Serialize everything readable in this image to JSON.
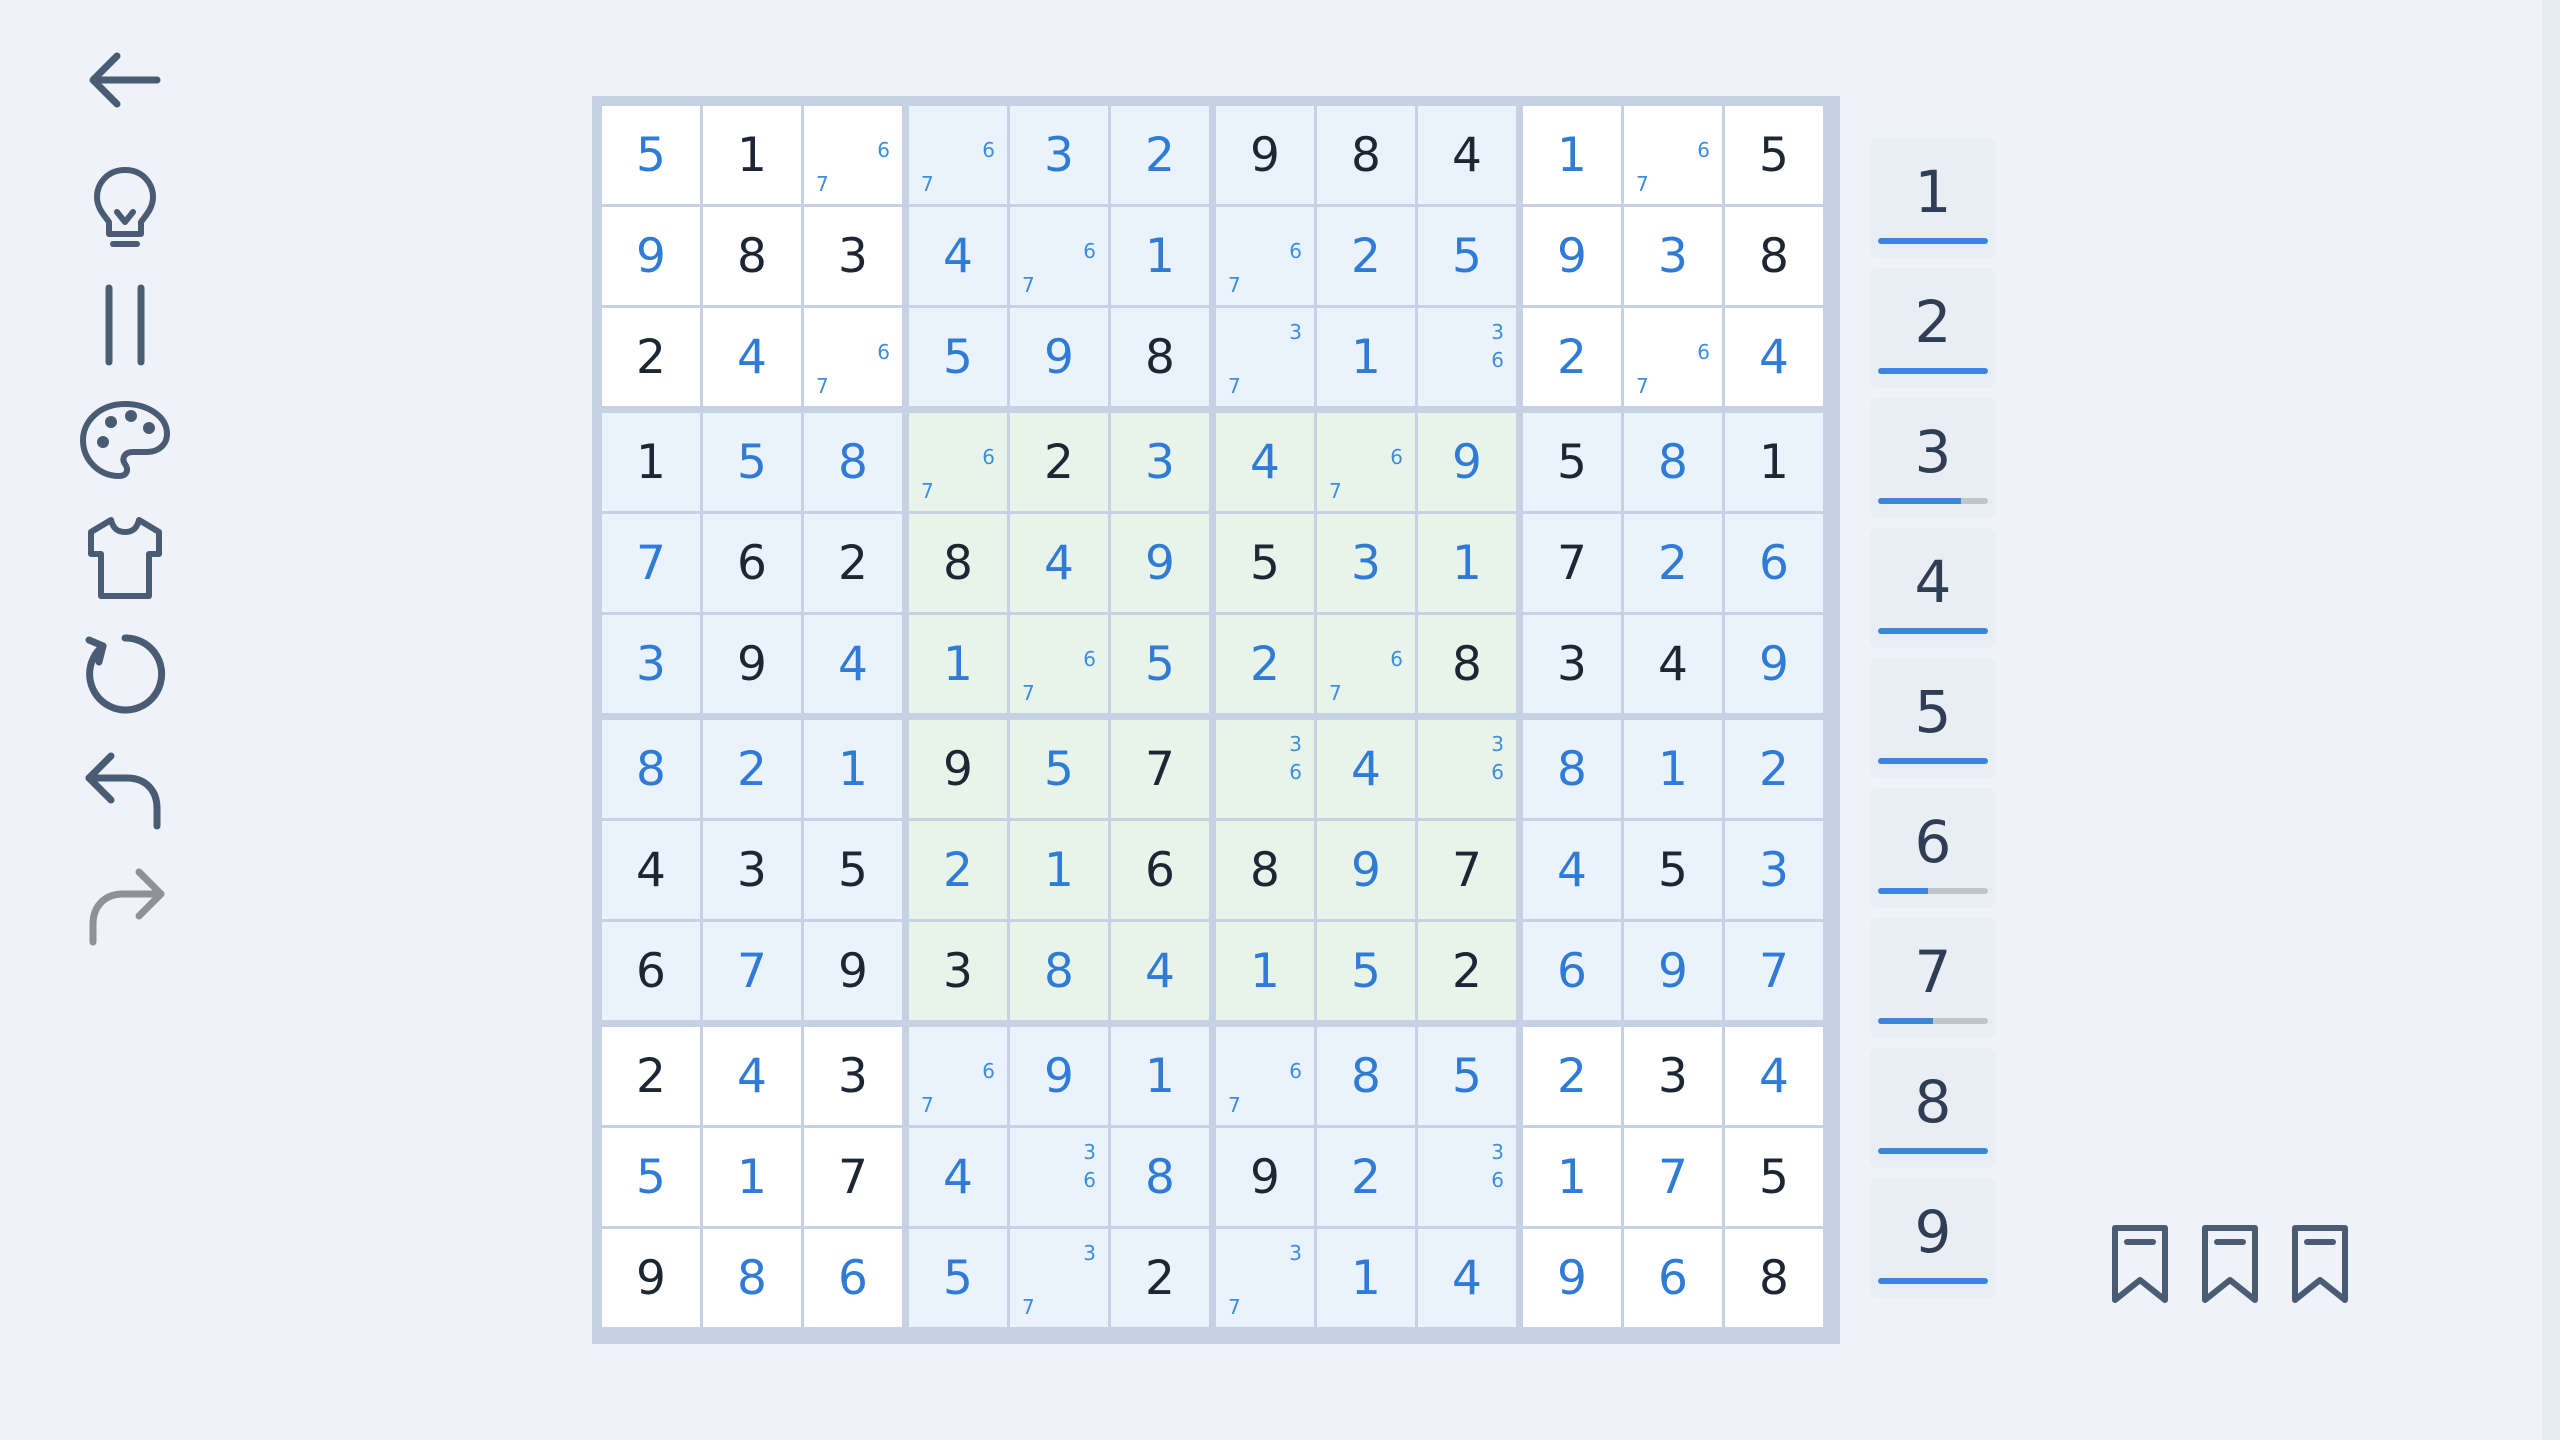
{
  "toolbar": {
    "icons": [
      "back-arrow-icon",
      "lightbulb-hint-icon",
      "pause-icon",
      "palette-icon",
      "shirt-icon",
      "restart-icon",
      "undo-icon",
      "redo-icon"
    ]
  },
  "board": {
    "rows": [
      [
        {
          "v": "5",
          "t": "u"
        },
        {
          "v": "1",
          "t": "g"
        },
        {
          "n": [
            "6",
            "7"
          ]
        },
        {
          "n": [
            "6",
            "7"
          ]
        },
        {
          "v": "3",
          "t": "u"
        },
        {
          "v": "2",
          "t": "u"
        },
        {
          "v": "9",
          "t": "g"
        },
        {
          "v": "8",
          "t": "g"
        },
        {
          "v": "4",
          "t": "g"
        },
        {
          "v": "1",
          "t": "u"
        },
        {
          "n": [
            "6",
            "7"
          ]
        },
        {
          "v": "5",
          "t": "g"
        }
      ],
      [
        {
          "v": "9",
          "t": "u"
        },
        {
          "v": "8",
          "t": "g"
        },
        {
          "v": "3",
          "t": "g"
        },
        {
          "v": "4",
          "t": "u"
        },
        {
          "n": [
            "6",
            "7"
          ]
        },
        {
          "v": "1",
          "t": "u"
        },
        {
          "n": [
            "6",
            "7"
          ]
        },
        {
          "v": "2",
          "t": "u"
        },
        {
          "v": "5",
          "t": "u"
        },
        {
          "v": "9",
          "t": "u"
        },
        {
          "v": "3",
          "t": "u"
        },
        {
          "v": "8",
          "t": "g"
        }
      ],
      [
        {
          "v": "2",
          "t": "g"
        },
        {
          "v": "4",
          "t": "u"
        },
        {
          "n": [
            "6",
            "7"
          ]
        },
        {
          "v": "5",
          "t": "u"
        },
        {
          "v": "9",
          "t": "u"
        },
        {
          "v": "8",
          "t": "g"
        },
        {
          "n": [
            "3",
            "7"
          ]
        },
        {
          "v": "1",
          "t": "u"
        },
        {
          "n": [
            "3",
            "6"
          ]
        },
        {
          "v": "2",
          "t": "u"
        },
        {
          "n": [
            "6",
            "7"
          ]
        },
        {
          "v": "4",
          "t": "u"
        }
      ],
      [
        {
          "v": "1",
          "t": "g"
        },
        {
          "v": "5",
          "t": "u"
        },
        {
          "v": "8",
          "t": "u"
        },
        {
          "n": [
            "6",
            "7"
          ]
        },
        {
          "v": "2",
          "t": "g"
        },
        {
          "v": "3",
          "t": "u"
        },
        {
          "v": "4",
          "t": "u"
        },
        {
          "n": [
            "6",
            "7"
          ]
        },
        {
          "v": "9",
          "t": "u"
        },
        {
          "v": "5",
          "t": "g"
        },
        {
          "v": "8",
          "t": "u"
        },
        {
          "v": "1",
          "t": "g"
        }
      ],
      [
        {
          "v": "7",
          "t": "u"
        },
        {
          "v": "6",
          "t": "g"
        },
        {
          "v": "2",
          "t": "g"
        },
        {
          "v": "8",
          "t": "g"
        },
        {
          "v": "4",
          "t": "u"
        },
        {
          "v": "9",
          "t": "u"
        },
        {
          "v": "5",
          "t": "g"
        },
        {
          "v": "3",
          "t": "u"
        },
        {
          "v": "1",
          "t": "u"
        },
        {
          "v": "7",
          "t": "g"
        },
        {
          "v": "2",
          "t": "u"
        },
        {
          "v": "6",
          "t": "u"
        }
      ],
      [
        {
          "v": "3",
          "t": "u"
        },
        {
          "v": "9",
          "t": "g"
        },
        {
          "v": "4",
          "t": "u"
        },
        {
          "v": "1",
          "t": "u"
        },
        {
          "n": [
            "6",
            "7"
          ]
        },
        {
          "v": "5",
          "t": "u"
        },
        {
          "v": "2",
          "t": "u"
        },
        {
          "n": [
            "6",
            "7"
          ]
        },
        {
          "v": "8",
          "t": "g"
        },
        {
          "v": "3",
          "t": "g"
        },
        {
          "v": "4",
          "t": "g"
        },
        {
          "v": "9",
          "t": "u"
        }
      ],
      [
        {
          "v": "8",
          "t": "u"
        },
        {
          "v": "2",
          "t": "u"
        },
        {
          "v": "1",
          "t": "u"
        },
        {
          "v": "9",
          "t": "g"
        },
        {
          "v": "5",
          "t": "u"
        },
        {
          "v": "7",
          "t": "g"
        },
        {
          "n": [
            "3",
            "6"
          ]
        },
        {
          "v": "4",
          "t": "u"
        },
        {
          "n": [
            "3",
            "6"
          ]
        },
        {
          "v": "8",
          "t": "u"
        },
        {
          "v": "1",
          "t": "u"
        },
        {
          "v": "2",
          "t": "u"
        }
      ],
      [
        {
          "v": "4",
          "t": "g"
        },
        {
          "v": "3",
          "t": "g"
        },
        {
          "v": "5",
          "t": "g"
        },
        {
          "v": "2",
          "t": "u"
        },
        {
          "v": "1",
          "t": "u"
        },
        {
          "v": "6",
          "t": "g"
        },
        {
          "v": "8",
          "t": "g"
        },
        {
          "v": "9",
          "t": "u"
        },
        {
          "v": "7",
          "t": "g"
        },
        {
          "v": "4",
          "t": "u"
        },
        {
          "v": "5",
          "t": "g"
        },
        {
          "v": "3",
          "t": "u"
        }
      ],
      [
        {
          "v": "6",
          "t": "g"
        },
        {
          "v": "7",
          "t": "u"
        },
        {
          "v": "9",
          "t": "g"
        },
        {
          "v": "3",
          "t": "g"
        },
        {
          "v": "8",
          "t": "u"
        },
        {
          "v": "4",
          "t": "u"
        },
        {
          "v": "1",
          "t": "u"
        },
        {
          "v": "5",
          "t": "u"
        },
        {
          "v": "2",
          "t": "g"
        },
        {
          "v": "6",
          "t": "u"
        },
        {
          "v": "9",
          "t": "u"
        },
        {
          "v": "7",
          "t": "u"
        }
      ],
      [
        {
          "v": "2",
          "t": "g"
        },
        {
          "v": "4",
          "t": "u"
        },
        {
          "v": "3",
          "t": "g"
        },
        {
          "n": [
            "6",
            "7"
          ]
        },
        {
          "v": "9",
          "t": "u"
        },
        {
          "v": "1",
          "t": "u"
        },
        {
          "n": [
            "6",
            "7"
          ]
        },
        {
          "v": "8",
          "t": "u"
        },
        {
          "v": "5",
          "t": "u"
        },
        {
          "v": "2",
          "t": "u"
        },
        {
          "v": "3",
          "t": "g"
        },
        {
          "v": "4",
          "t": "u"
        }
      ],
      [
        {
          "v": "5",
          "t": "u"
        },
        {
          "v": "1",
          "t": "u"
        },
        {
          "v": "7",
          "t": "g"
        },
        {
          "v": "4",
          "t": "u"
        },
        {
          "n": [
            "3",
            "6"
          ]
        },
        {
          "v": "8",
          "t": "u"
        },
        {
          "v": "9",
          "t": "g"
        },
        {
          "v": "2",
          "t": "u"
        },
        {
          "n": [
            "3",
            "6"
          ]
        },
        {
          "v": "1",
          "t": "u"
        },
        {
          "v": "7",
          "t": "u"
        },
        {
          "v": "5",
          "t": "g"
        }
      ],
      [
        {
          "v": "9",
          "t": "g"
        },
        {
          "v": "8",
          "t": "u"
        },
        {
          "v": "6",
          "t": "u"
        },
        {
          "v": "5",
          "t": "u"
        },
        {
          "n": [
            "3",
            "7"
          ]
        },
        {
          "v": "2",
          "t": "g"
        },
        {
          "n": [
            "3",
            "7"
          ]
        },
        {
          "v": "1",
          "t": "u"
        },
        {
          "v": "4",
          "t": "u"
        },
        {
          "v": "9",
          "t": "u"
        },
        {
          "v": "6",
          "t": "u"
        },
        {
          "v": "8",
          "t": "g"
        }
      ]
    ]
  },
  "numpad": [
    {
      "digit": "1",
      "progress": 1.0
    },
    {
      "digit": "2",
      "progress": 1.0
    },
    {
      "digit": "3",
      "progress": 0.75
    },
    {
      "digit": "4",
      "progress": 1.0
    },
    {
      "digit": "5",
      "progress": 1.0
    },
    {
      "digit": "6",
      "progress": 0.45
    },
    {
      "digit": "7",
      "progress": 0.5
    },
    {
      "digit": "8",
      "progress": 1.0
    },
    {
      "digit": "9",
      "progress": 1.0
    }
  ],
  "bookmarks": [
    "bookmark-icon",
    "bookmark-icon",
    "bookmark-icon"
  ],
  "colors": {
    "given": "#1d2733",
    "user": "#2f7bd6",
    "note": "#3d8ee0",
    "accent": "#3c85dd",
    "icon": "#4a5b74",
    "icon_disabled": "#8e9196"
  }
}
